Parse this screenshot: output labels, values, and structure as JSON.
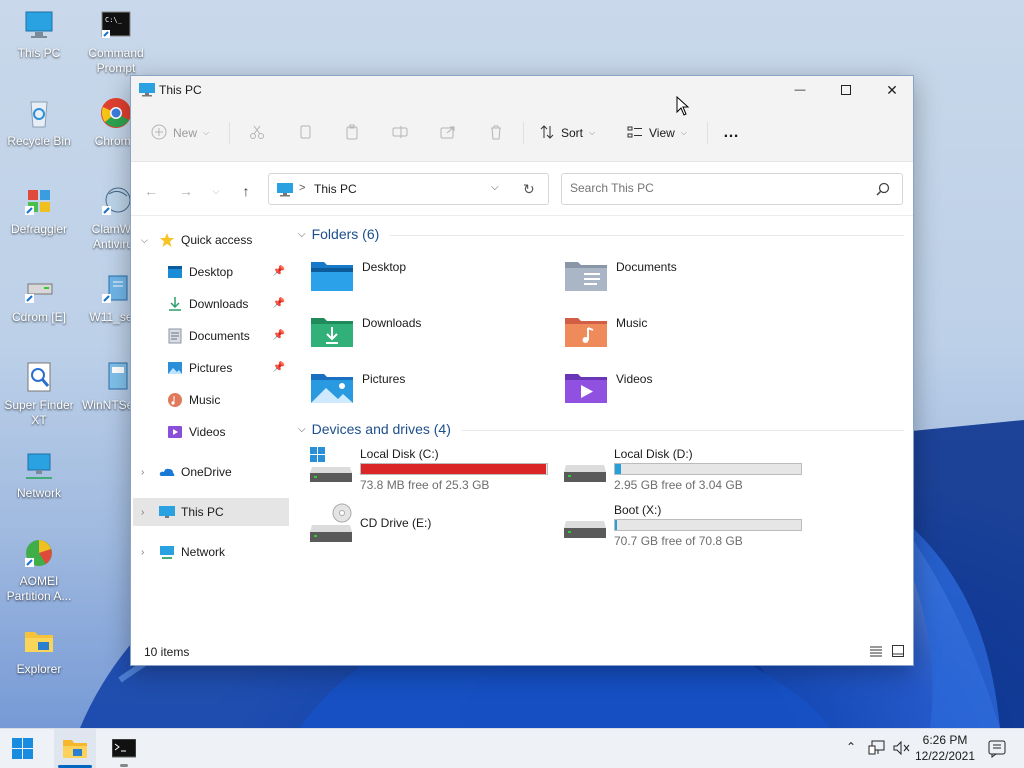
{
  "desktop": {
    "icons": [
      {
        "label": "This PC"
      },
      {
        "label": "Command Prompt"
      },
      {
        "label": "Recycle Bin"
      },
      {
        "label": "Chrome"
      },
      {
        "label": "Defraggler"
      },
      {
        "label": "ClamWin Antivirus"
      },
      {
        "label": "Cdrom [E]"
      },
      {
        "label": "W11_se..."
      },
      {
        "label": "Super Finder XT"
      },
      {
        "label": "WinNTSetup"
      },
      {
        "label": "Network"
      },
      {
        "label": "AOMEI Partition A..."
      },
      {
        "label": "Explorer"
      }
    ]
  },
  "window": {
    "title": "This PC",
    "controls": {
      "minimize": "—",
      "maximize": "☐",
      "close": "✕"
    }
  },
  "command_bar": {
    "new_label": "New",
    "sort_label": "Sort",
    "view_label": "View",
    "more_label": "…"
  },
  "address": {
    "path": "This PC",
    "separator": ">",
    "search_placeholder": "Search This PC"
  },
  "sidebar": {
    "quick_access": "Quick access",
    "items": [
      {
        "label": "Desktop",
        "pinned": true
      },
      {
        "label": "Downloads",
        "pinned": true
      },
      {
        "label": "Documents",
        "pinned": true
      },
      {
        "label": "Pictures",
        "pinned": true
      },
      {
        "label": "Music",
        "pinned": false
      },
      {
        "label": "Videos",
        "pinned": false
      }
    ],
    "onedrive": "OneDrive",
    "this_pc": "This PC",
    "network": "Network"
  },
  "content": {
    "folders_header": "Folders (6)",
    "folders": [
      {
        "label": "Desktop"
      },
      {
        "label": "Documents"
      },
      {
        "label": "Downloads"
      },
      {
        "label": "Music"
      },
      {
        "label": "Pictures"
      },
      {
        "label": "Videos"
      }
    ],
    "drives_header": "Devices and drives (4)",
    "drives": [
      {
        "label": "Local Disk (C:)",
        "free": "73.8 MB free of 25.3 GB",
        "used_fraction": 0.997,
        "bar_color": "#da2626"
      },
      {
        "label": "Local Disk (D:)",
        "free": "2.95 GB free of 3.04 GB",
        "used_fraction": 0.03,
        "bar_color": "#26a0da"
      },
      {
        "label": "CD Drive (E:)"
      },
      {
        "label": "Boot (X:)",
        "free": "70.7 GB free of 70.8 GB",
        "used_fraction": 0.002,
        "bar_color": "#26a0da"
      }
    ]
  },
  "status": {
    "items": "10 items"
  },
  "taskbar": {
    "time": "6:26 PM",
    "date": "12/22/2021"
  },
  "colors": {
    "accent": "#0067c0",
    "folder_header": "#1c4f8c",
    "drive_critical": "#da2626",
    "drive_normal": "#26a0da"
  }
}
